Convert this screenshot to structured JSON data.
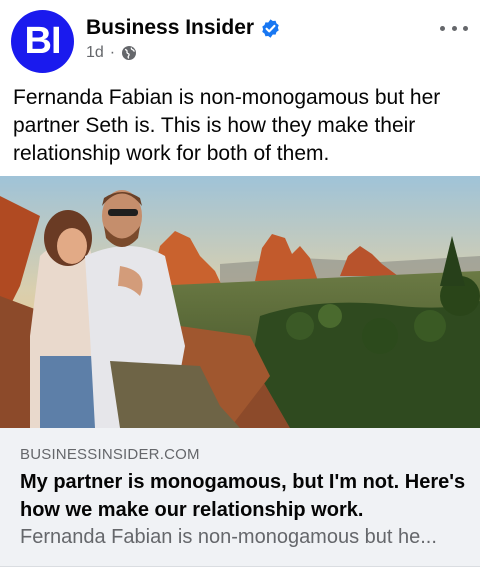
{
  "post": {
    "page_name": "Business Insider",
    "avatar_text": "BI",
    "timestamp": "1d",
    "separator": "·",
    "audience_icon": "globe-icon",
    "verified_icon": "verified-badge-icon",
    "more_icon": "more-horizontal-icon",
    "caption": "Fernanda Fabian is non-monogamous but her partner Seth is. This is how they make their relationship work for both of them."
  },
  "link_preview": {
    "domain": "BUSINESSINSIDER.COM",
    "title": "My partner is monogamous, but I'm not. Here's how we make our relationship work.",
    "description": "Fernanda Fabian is non-monogamous but he..."
  },
  "colors": {
    "brand_blue": "#1a1aee",
    "verified_blue": "#1877f2",
    "secondary_text": "#65676b",
    "link_box_bg": "#f0f2f5"
  }
}
